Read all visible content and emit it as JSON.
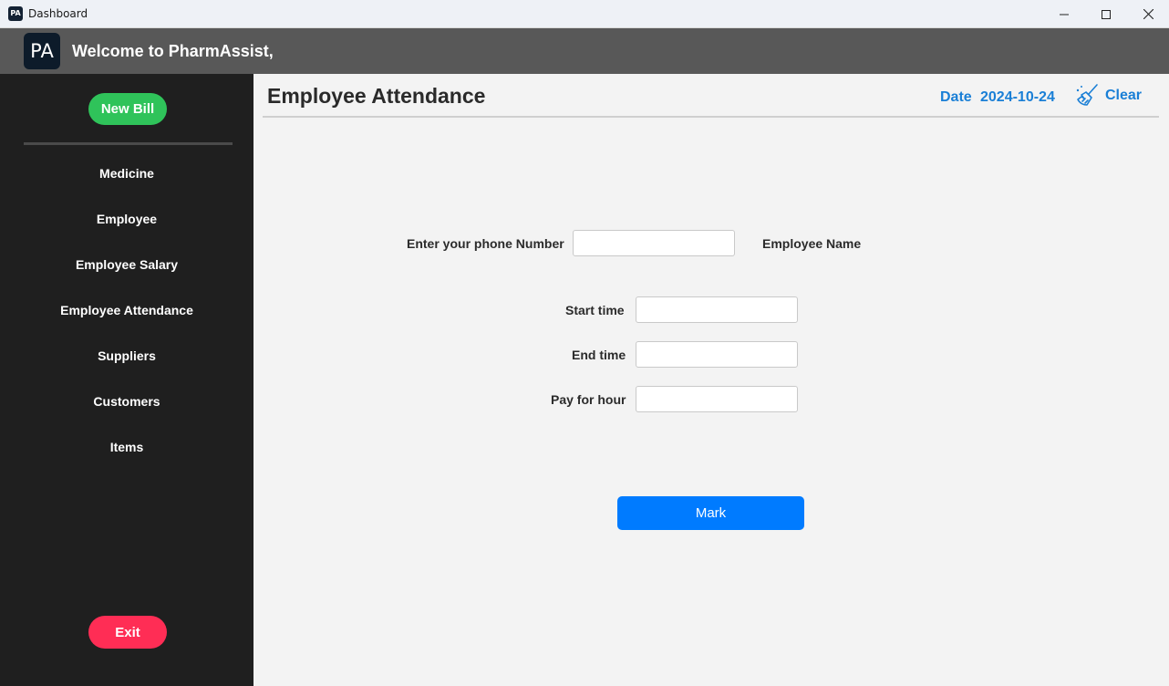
{
  "window": {
    "icon_text": "PA",
    "title": "Dashboard"
  },
  "header": {
    "logo_text": "PA",
    "welcome": "Welcome to PharmAssist,"
  },
  "sidebar": {
    "new_bill": "New Bill",
    "items": [
      {
        "label": "Medicine"
      },
      {
        "label": "Employee"
      },
      {
        "label": "Employee Salary"
      },
      {
        "label": "Employee Attendance"
      },
      {
        "label": "Suppliers"
      },
      {
        "label": "Customers"
      },
      {
        "label": "Items"
      }
    ],
    "exit": "Exit"
  },
  "main": {
    "title": "Employee Attendance",
    "date_label": "Date",
    "date_value": "2024-10-24",
    "clear_label": "Clear",
    "form": {
      "phone_label": "Enter your phone Number",
      "phone_value": "",
      "employee_name_label": "Employee Name",
      "start_time_label": "Start time",
      "start_time_value": "",
      "end_time_label": "End time",
      "end_time_value": "",
      "pay_label": "Pay for hour",
      "pay_value": "",
      "mark_label": "Mark"
    }
  },
  "colors": {
    "accent_blue": "#007bff",
    "link_blue": "#1a7fd6",
    "new_bill_green": "#2fc35a",
    "exit_red": "#ff2d55",
    "sidebar_bg": "#1f1f1f",
    "header_bg": "#585858"
  }
}
